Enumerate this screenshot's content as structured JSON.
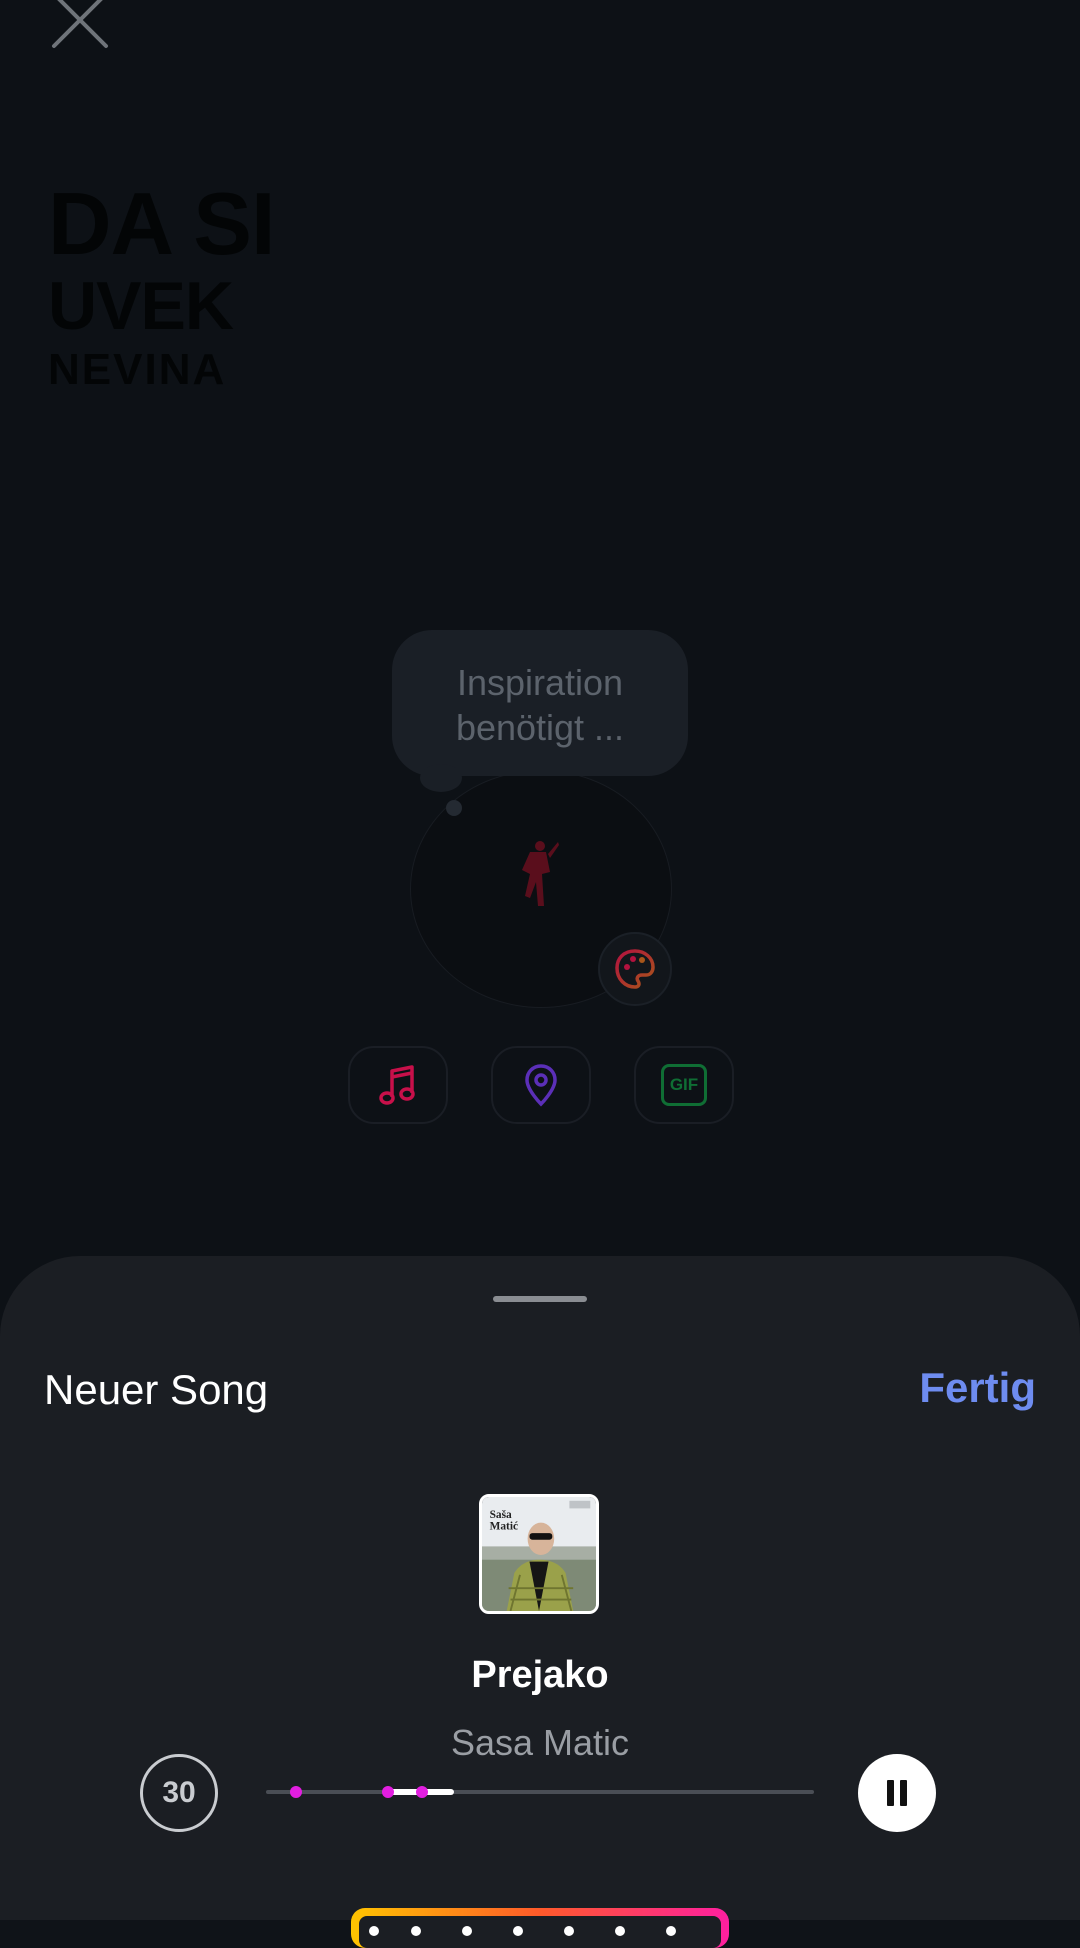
{
  "headline": {
    "line1": "DA SI",
    "line2": "UVEK",
    "line3": "NEVINA"
  },
  "bubble": {
    "line1": "Inspiration",
    "line2": "benötigt ..."
  },
  "stickers": {
    "gif_label": "GIF"
  },
  "sheet": {
    "title": "Neuer Song",
    "done_label": "Fertig",
    "song": {
      "title": "Prejako",
      "artist": "Sasa Matic"
    },
    "album_text": {
      "artist_line1": "Saša",
      "artist_line2": "Matić"
    },
    "duration": "30",
    "clip_progress": {
      "start_fraction": 0.22,
      "end_fraction": 0.34
    }
  },
  "colors": {
    "accent_blue": "#6e8cf0",
    "marker_pink": "#e21ee0",
    "gif_green": "#0f6e34",
    "music_pink": "#c8104a",
    "location_purple": "#5b2fb8"
  },
  "icons": [
    "close-icon",
    "polo-logo",
    "palette-icon",
    "music-note-icon",
    "location-pin-icon",
    "gif-icon",
    "pause-icon"
  ]
}
